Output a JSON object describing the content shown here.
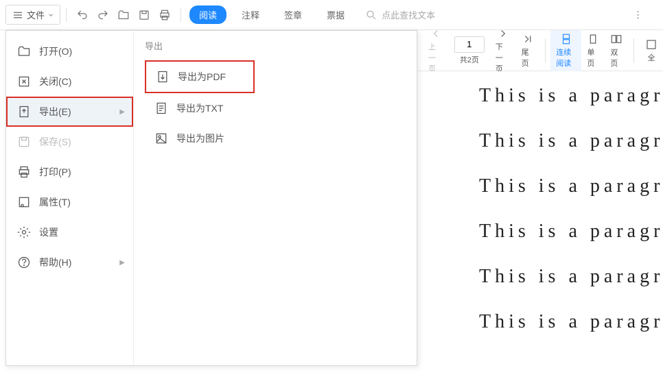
{
  "toolbar": {
    "file_label": "文件",
    "tabs": {
      "read": "阅读",
      "annotate": "注释",
      "sign": "签章",
      "ticket": "票据"
    },
    "search_placeholder": "点此查找文本"
  },
  "nav": {
    "prev": "上一页",
    "total": "共2页",
    "current": "1",
    "next": "下一页",
    "last": "尾页",
    "continuous": "连续阅读",
    "single": "单页",
    "double": "双页",
    "full": "全"
  },
  "menu": {
    "open": "打开(O)",
    "close": "关闭(C)",
    "export": "导出(E)",
    "save": "保存(S)",
    "print": "打印(P)",
    "props": "属性(T)",
    "settings": "设置",
    "help": "帮助(H)"
  },
  "submenu": {
    "title": "导出",
    "pdf": "导出为PDF",
    "txt": "导出为TXT",
    "img": "导出为图片"
  },
  "doc": {
    "lines": [
      "This is a paragraph",
      "This is a paragraph",
      "This is a paragraph",
      "This is a paragraph",
      "This is a paragraph",
      "This is a paragraph"
    ]
  }
}
